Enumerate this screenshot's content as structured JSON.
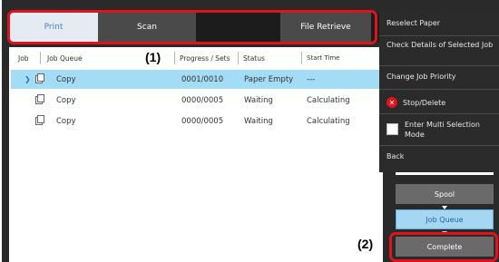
{
  "tabs": {
    "print": "Print",
    "scan": "Scan",
    "file_retrieve": "File Retrieve",
    "scroll_arrow": "›"
  },
  "table": {
    "headers": {
      "job": "Job",
      "queue": "Job Queue",
      "progress": "Progress / Sets",
      "status": "Status",
      "start_time": "Start Time"
    },
    "rows": [
      {
        "queue": "Copy",
        "progress": "0001/0010",
        "status": "Paper Empty",
        "start_time": "---"
      },
      {
        "queue": "Copy",
        "progress": "0000/0005",
        "status": "Waiting",
        "start_time": "Calculating"
      },
      {
        "queue": "Copy",
        "progress": "0000/0005",
        "status": "Waiting",
        "start_time": "Calculating"
      }
    ]
  },
  "menu": {
    "reselect_paper": "Reselect Paper",
    "check_details": "Check Details of Selected Job",
    "change_priority": "Change Job Priority",
    "stop_delete": "Stop/Delete",
    "multi_select": "Enter Multi Selection Mode",
    "back": "Back"
  },
  "buttons": {
    "spool": "Spool",
    "job_queue": "Job Queue",
    "complete": "Complete"
  },
  "callouts": {
    "one": "(1)",
    "two": "(2)"
  },
  "colors": {
    "accent_red": "#e0131c",
    "selected_row": "#a4dcf5",
    "active_tab_text": "#4a83c6"
  }
}
